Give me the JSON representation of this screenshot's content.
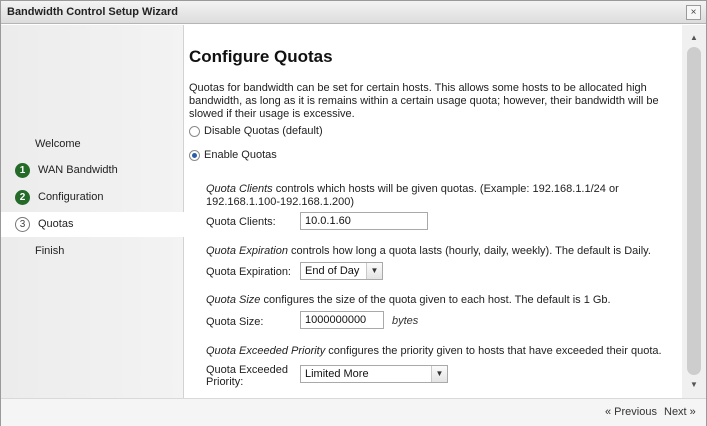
{
  "window": {
    "title": "Bandwidth Control Setup Wizard",
    "close_glyph": "×"
  },
  "steps": [
    {
      "label": "Welcome",
      "marker": ""
    },
    {
      "label": "WAN Bandwidth",
      "marker": "1"
    },
    {
      "label": "Configuration",
      "marker": "2"
    },
    {
      "label": "Quotas",
      "marker": "3"
    },
    {
      "label": "Finish",
      "marker": ""
    }
  ],
  "page": {
    "heading": "Configure Quotas",
    "description": "Quotas for bandwidth can be set for certain hosts. This allows some hosts to be allocated high bandwidth, as long as it is remains within a certain usage quota; however, their bandwidth will be slowed if their usage is excessive.",
    "options": {
      "disable_label": "Disable Quotas (default)",
      "enable_label": "Enable Quotas",
      "selected": "enable"
    }
  },
  "clients": {
    "help_term": "Quota Clients",
    "help_text": " controls which hosts will be given quotas. (Example: 192.168.1.1/24 or 192.168.1.100-192.168.1.200)",
    "label": "Quota Clients:",
    "value": "10.0.1.60"
  },
  "expiration": {
    "help_term": "Quota Expiration",
    "help_text": " controls how long a quota lasts (hourly, daily, weekly). The default is Daily.",
    "label": "Quota Expiration:",
    "value": "End of Day"
  },
  "size": {
    "help_term": "Quota Size",
    "help_text": " configures the size of the quota given to each host. The default is 1 Gb.",
    "label": "Quota Size:",
    "value": "1000000000",
    "unit": "bytes"
  },
  "priority": {
    "help_term": "Quota Exceeded Priority",
    "help_text": " configures the priority given to hosts that have exceeded their quota.",
    "label_line1": "Quota Exceeded",
    "label_line2": "Priority:",
    "value": "Limited More"
  },
  "footer": {
    "previous_label": "« Previous",
    "next_label": "Next »"
  },
  "icons": {
    "chevron": "▼",
    "scroll_up": "▲",
    "scroll_down": "▼"
  }
}
